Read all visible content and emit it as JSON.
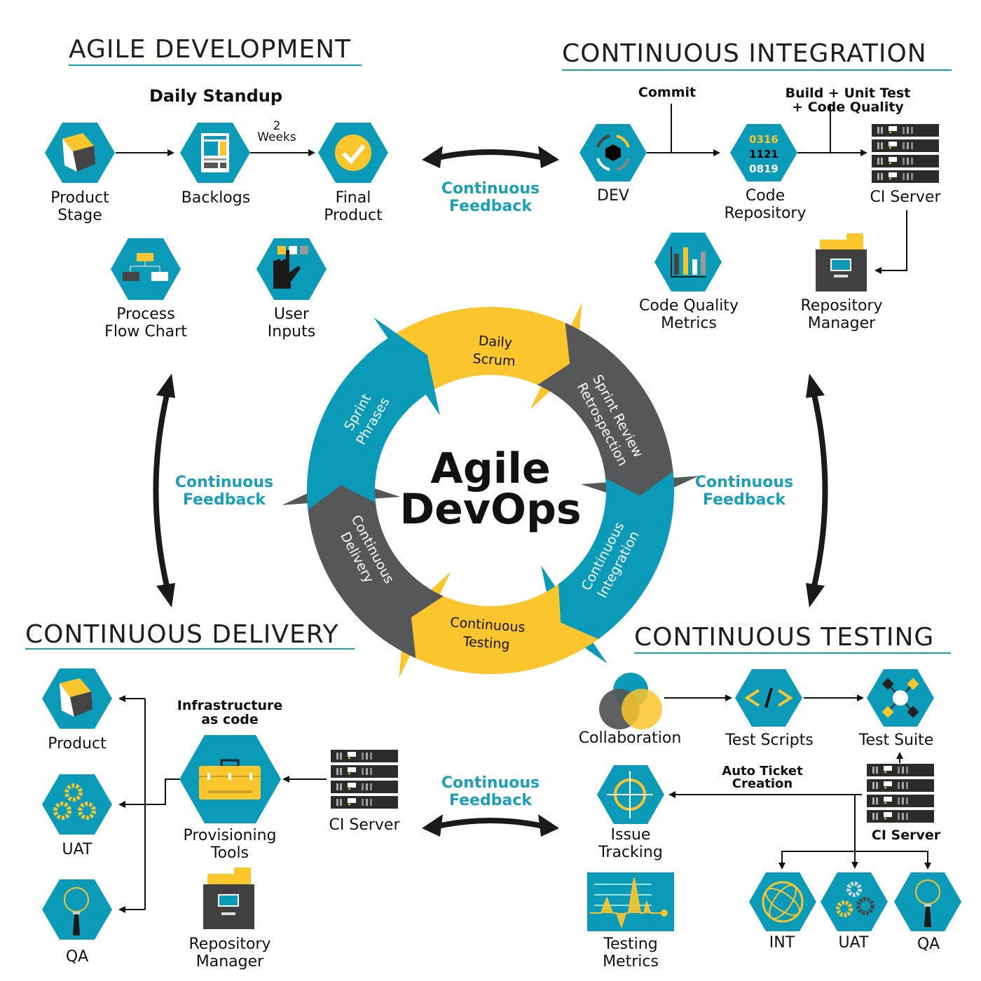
{
  "colors": {
    "teal": "#0b9bb8",
    "yellow": "#fbc52d",
    "dark": "#555759",
    "black": "#1a1a1a",
    "accent_text": "#1ba0b8"
  },
  "center": {
    "line1": "Agile",
    "line2": "DevOps"
  },
  "cycle": [
    {
      "label": "Daily\nScrum",
      "color": "yellow"
    },
    {
      "label": "Sprint Review\nRetrospection",
      "color": "dark"
    },
    {
      "label": "Continuous\nIntegration",
      "color": "teal"
    },
    {
      "label": "Continuous\nTesting",
      "color": "yellow"
    },
    {
      "label": "Continuous\nDelivery",
      "color": "dark"
    },
    {
      "label": "Sprint\nPhrases",
      "color": "teal"
    }
  ],
  "feedback_label": "Continuous\nFeedback",
  "agile": {
    "title": "AGILE DEVELOPMENT",
    "subtitle": "Daily Standup",
    "interval": "2\nWeeks",
    "nodes": {
      "product_stage": "Product\nStage",
      "backlogs": "Backlogs",
      "final_product": "Final\nProduct",
      "process_flow": "Process\nFlow Chart",
      "user_inputs": "User\nInputs"
    }
  },
  "ci": {
    "title": "CONTINUOUS INTEGRATION",
    "commit": "Commit",
    "build": "Build + Unit Test + Code Quality",
    "repo_code": [
      "0316",
      "1121",
      "0819"
    ],
    "nodes": {
      "dev": "DEV",
      "code_repo": "Code\nRepository",
      "ci_server": "CI Server",
      "code_quality": "Code Quality\nMetrics",
      "repo_manager": "Repository\nManager"
    }
  },
  "cd": {
    "title": "CONTINUOUS DELIVERY",
    "iac": "Infrastructure\nas code",
    "nodes": {
      "product": "Product",
      "uat": "UAT",
      "qa": "QA",
      "provisioning": "Provisioning\nTools",
      "ci_server": "CI Server",
      "repo_manager": "Repository\nManager"
    }
  },
  "ct": {
    "title": "CONTINUOUS TESTING",
    "auto_ticket": "Auto Ticket\nCreation",
    "nodes": {
      "collaboration": "Collaboration",
      "test_scripts": "Test Scripts",
      "test_suite": "Test Suite",
      "issue_tracking": "Issue\nTracking",
      "ci_server": "CI Server",
      "testing_metrics": "Testing\nMetrics",
      "int": "INT",
      "uat": "UAT",
      "qa": "QA"
    }
  }
}
